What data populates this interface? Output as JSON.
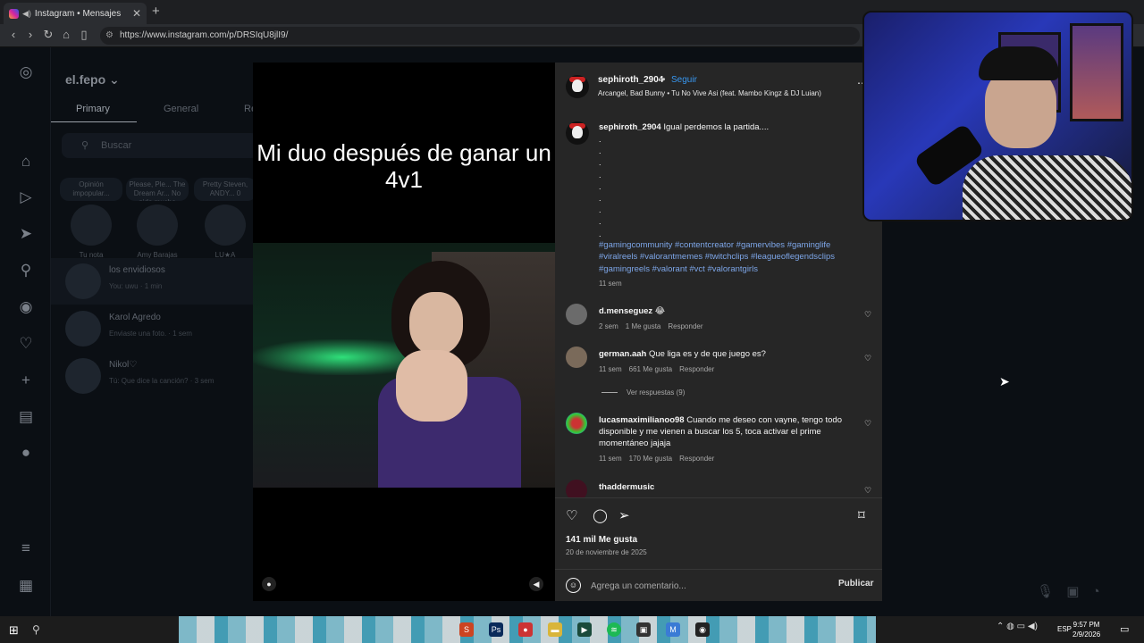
{
  "browser": {
    "tab_title": "Instagram • Mensajes",
    "url": "https://www.instagram.com/p/DRSIqU8jlI9/"
  },
  "dm_page": {
    "username": "el.fepo",
    "tabs": [
      "Primary",
      "General",
      "Re"
    ],
    "search_placeholder": "Buscar",
    "notes": [
      {
        "bubble": "Opinión impopular...",
        "name": "Tu nota"
      },
      {
        "bubble": "Please, Ple... The Dream Ar... No pido mucho",
        "name": "Amy Barajas"
      },
      {
        "bubble": "Pretty Steven, ANDY... 0",
        "name": "LU★A"
      }
    ],
    "conversations": [
      {
        "name": "los envidiosos",
        "sub": "You: uwu · 1 min"
      },
      {
        "name": "Karol Agredo",
        "sub": "Enviaste una foto. · 1 sem"
      },
      {
        "name": "Nikol♡",
        "sub": "Tú: Que dice la canción? · 3 sem"
      }
    ]
  },
  "post": {
    "media_caption": "Mi duo después de ganar un 4v1",
    "author": "sephiroth_2904",
    "follow_label": "Seguir",
    "song": "Arcangel, Bad Bunny • Tu No Vive Asi (feat. Mambo Kingz & DJ Luian)",
    "caption_text": "Igual perdemos la partida....",
    "hashtags": "#gamingcommunity #contentcreator #gamervibes #gaminglife #viralreels #valorantmemes #twitchclips #leagueoflegendsclips #gamingreels #valorant #vct #valorantgirls",
    "caption_time": "11 sem",
    "comments": [
      {
        "user": "d.menseguez",
        "text": "😂",
        "time": "2 sem",
        "likes": "1 Me gusta",
        "reply": "Responder"
      },
      {
        "user": "german.aah",
        "text": "Que liga es y de que juego es?",
        "time": "11 sem",
        "likes": "661 Me gusta",
        "reply": "Responder"
      },
      {
        "user": "lucasmaximilianoo98",
        "text": "Cuando me deseo con vayne, tengo todo disponible y me vienen a buscar los 5, toca activar el prime momentáneo jajaja",
        "time": "11 sem",
        "likes": "170 Me gusta",
        "reply": "Responder"
      },
      {
        "user": "thaddermusic",
        "text": "",
        "time": "",
        "likes": "",
        "reply": ""
      }
    ],
    "view_replies": "Ver respuestas (9)",
    "likes_total": "141 mil Me gusta",
    "date": "20 de noviembre de 2025",
    "comment_placeholder": "Agrega un comentario...",
    "publish_label": "Publicar"
  },
  "taskbar": {
    "lang": "ESP",
    "time": "9:57 PM",
    "date": "2/9/2026"
  }
}
